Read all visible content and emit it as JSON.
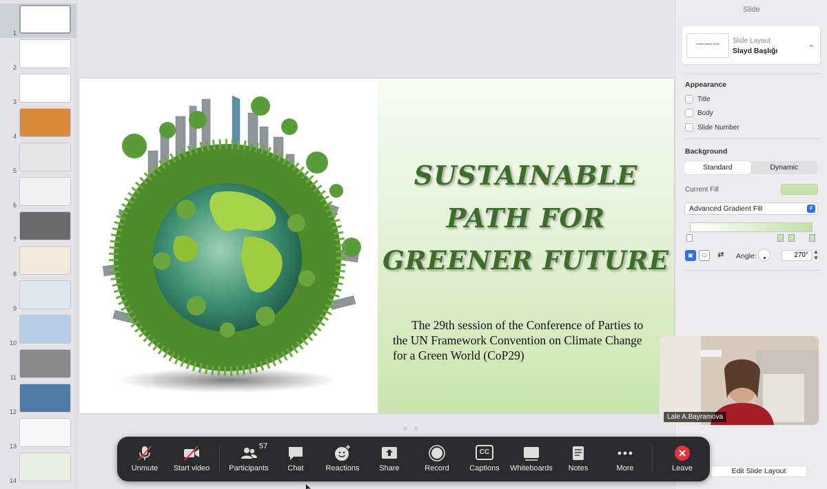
{
  "thumbnails": [
    {
      "num": "1",
      "bg": "#ffffff",
      "selected": true
    },
    {
      "num": "2",
      "bg": "#ffffff",
      "selected": false
    },
    {
      "num": "3",
      "bg": "#ffffff",
      "selected": false
    },
    {
      "num": "4",
      "bg": "#d98a3a",
      "selected": false
    },
    {
      "num": "5",
      "bg": "#e8e8e8",
      "selected": false
    },
    {
      "num": "6",
      "bg": "#f2f2f2",
      "selected": false
    },
    {
      "num": "7",
      "bg": "#6b6b6b",
      "selected": false
    },
    {
      "num": "8",
      "bg": "#f3e8dc",
      "selected": false
    },
    {
      "num": "9",
      "bg": "#dfe7ef",
      "selected": false
    },
    {
      "num": "10",
      "bg": "#b9cde8",
      "selected": false
    },
    {
      "num": "11",
      "bg": "#8a8a8a",
      "selected": false
    },
    {
      "num": "12",
      "bg": "#4f7aa8",
      "selected": false
    },
    {
      "num": "13",
      "bg": "#f7f7f7",
      "selected": false
    },
    {
      "num": "14",
      "bg": "#e9eee0",
      "selected": false
    }
  ],
  "slide": {
    "title_lines": [
      "SUSTAINABLE",
      "PATH FOR",
      "GREENER FUTURE"
    ],
    "subtitle_lines": [
      "The 29th session of the Conference of Parties to",
      "the UN Framework Convention on Climate Change",
      "for a Green World (CoP29)"
    ]
  },
  "inspector": {
    "header": "Slide",
    "layout_label": "Slide Layout",
    "layout_value": "Slayd Başlığı",
    "layout_thumb_text": "Lorem Ipsum Dolor",
    "appearance_label": "Appearance",
    "checkboxes": [
      "Title",
      "Body",
      "Slide Number"
    ],
    "background_label": "Background",
    "seg_standard": "Standard",
    "seg_dynamic": "Dynamic",
    "current_fill_label": "Current Fill",
    "fill_type": "Advanced Gradient Fill",
    "angle_label": "Angle:",
    "angle_value": "270°",
    "edit_layout": "Edit Slide Layout"
  },
  "video": {
    "name": "Lale A.Bayramova"
  },
  "toolbar": {
    "unmute": "Unmute",
    "start_video": "Start video",
    "participants": "Participants",
    "participants_count": "57",
    "chat": "Chat",
    "reactions": "Reactions",
    "share": "Share",
    "record": "Record",
    "captions": "Captions",
    "captions_icon": "CC",
    "whiteboards": "Whiteboards",
    "notes": "Notes",
    "more": "More",
    "leave": "Leave"
  },
  "colors": {
    "leave_red": "#e5303e",
    "slide_title_green": "#3f6b2c",
    "toolbar_bg": "#2b2b2d"
  }
}
